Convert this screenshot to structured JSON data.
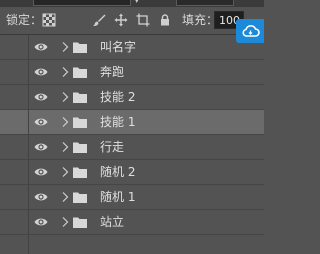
{
  "lock_row": {
    "lock_label": "锁定：",
    "fill_label": "填充：",
    "fill_value": "100",
    "icons": [
      "lock-transparent-pixels-icon",
      "brush-icon",
      "move-icon",
      "artboard-crop-icon",
      "lock-icon"
    ]
  },
  "cloud_button": {
    "icon": "cloud-sync-icon",
    "color": "#1c8ad8"
  },
  "layers": [
    {
      "name": "叫名字",
      "selected": false
    },
    {
      "name": "奔跑",
      "selected": false
    },
    {
      "name": "技能 2",
      "selected": false
    },
    {
      "name": "技能 1",
      "selected": true
    },
    {
      "name": "行走",
      "selected": false
    },
    {
      "name": "随机 2",
      "selected": false
    },
    {
      "name": "随机 1",
      "selected": false
    },
    {
      "name": "站立",
      "selected": false
    }
  ],
  "colors": {
    "panel_bg": "#535353",
    "selected_row": "#6b6b6b",
    "accent": "#1c8ad8"
  }
}
